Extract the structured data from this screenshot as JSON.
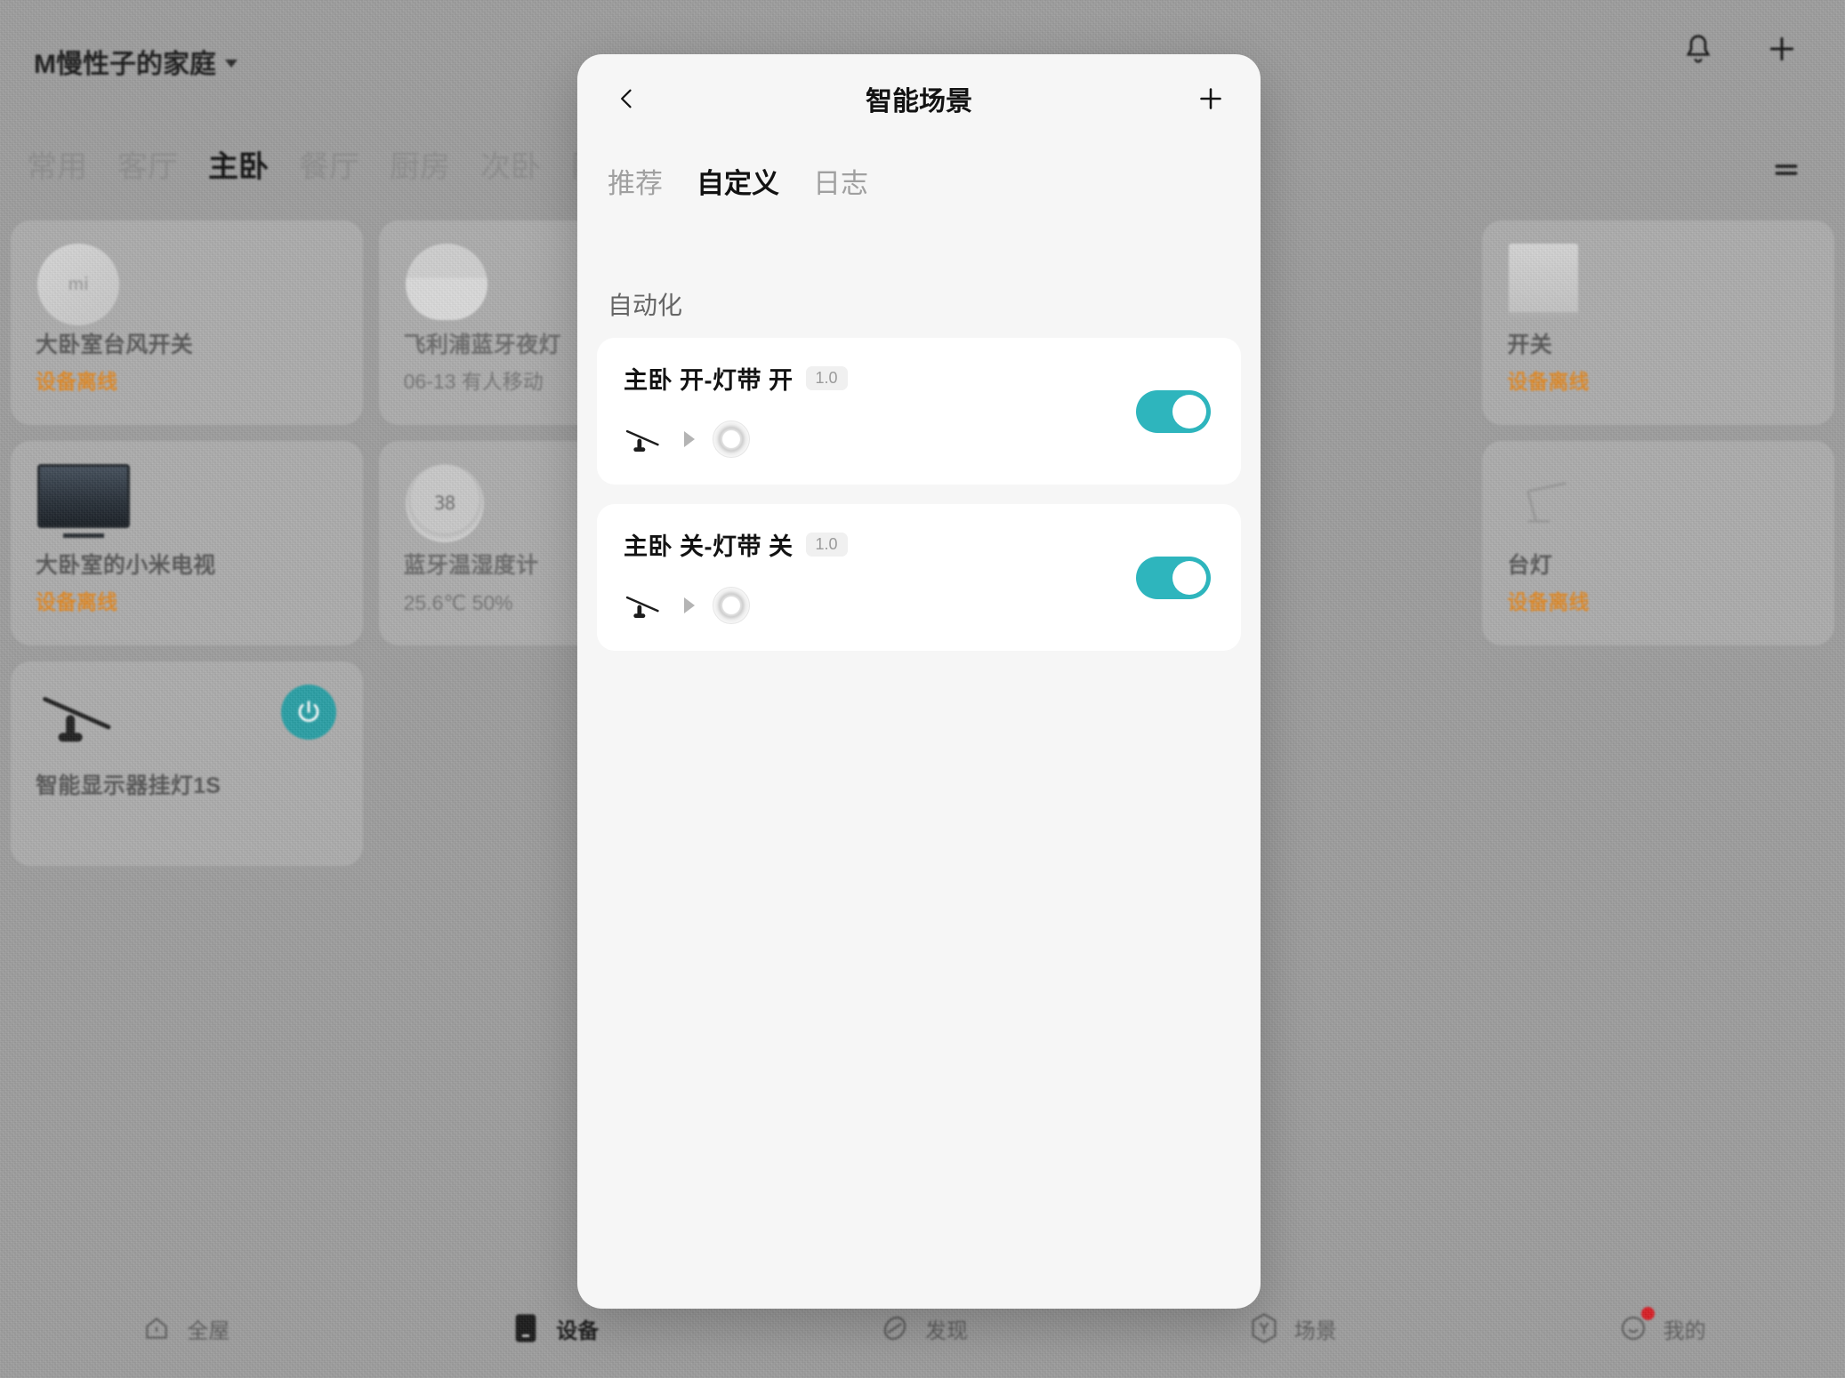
{
  "header": {
    "home_name": "M慢性子的家庭",
    "caret_icon": "chevron-down-icon",
    "bell_icon": "bell-icon",
    "add_icon": "plus-icon"
  },
  "room_tabs": {
    "items": [
      {
        "label": "常用",
        "active": false
      },
      {
        "label": "客厅",
        "active": false
      },
      {
        "label": "主卧",
        "active": true
      },
      {
        "label": "餐厅",
        "active": false
      },
      {
        "label": "厨房",
        "active": false
      },
      {
        "label": "次卧",
        "active": false
      },
      {
        "label": "阳",
        "active": false
      }
    ],
    "menu_icon": "list-menu-icon"
  },
  "devices": [
    {
      "name": "大卧室台风开关",
      "status": "设备离线",
      "offline": true,
      "thumb": "round-switch-icon",
      "power": false
    },
    {
      "name": "飞利浦蓝牙夜灯",
      "status": "06-13 有人移动",
      "offline": false,
      "thumb": "nightlight-icon",
      "power": false
    },
    {
      "name": "",
      "status": "",
      "offline": false,
      "thumb": "",
      "power": false
    },
    {
      "name": "开关",
      "status": "设备离线",
      "offline": true,
      "thumb": "square-switch-icon",
      "power": false
    },
    {
      "name": "大卧室的小米电视",
      "status": "设备离线",
      "offline": true,
      "thumb": "tv-icon",
      "power": false
    },
    {
      "name": "蓝牙温湿度计",
      "status": "25.6℃ 50%",
      "offline": false,
      "thumb": "thermometer-icon",
      "power": false
    },
    {
      "name": "",
      "status": "",
      "offline": false,
      "thumb": "",
      "power": false
    },
    {
      "name": "台灯",
      "status": "设备离线",
      "offline": true,
      "thumb": "desklamp-icon",
      "power": false
    },
    {
      "name": "智能显示器挂灯1S",
      "status": "",
      "offline": false,
      "thumb": "monitor-light-icon",
      "power": true
    }
  ],
  "device_thermo_display": "38",
  "device_switch_brand": "mi",
  "modal": {
    "back_icon": "chevron-left-icon",
    "title": "智能场景",
    "add_icon": "plus-icon",
    "tabs": [
      {
        "label": "推荐",
        "active": false
      },
      {
        "label": "自定义",
        "active": true
      },
      {
        "label": "日志",
        "active": false
      }
    ],
    "section_title": "自动化",
    "automations": [
      {
        "title": "主卧 开-灯带 开",
        "version_badge": "1.0",
        "trigger_icon": "monitor-light-icon",
        "arrow_icon": "arrow-right-icon",
        "action_icon": "light-ring-icon",
        "enabled": true
      },
      {
        "title": "主卧 关-灯带 关",
        "version_badge": "1.0",
        "trigger_icon": "monitor-light-icon",
        "arrow_icon": "arrow-right-icon",
        "action_icon": "light-ring-icon",
        "enabled": true
      }
    ]
  },
  "bottom_nav": [
    {
      "label": "全屋",
      "icon": "home-icon",
      "active": false,
      "badge": false
    },
    {
      "label": "设备",
      "icon": "device-icon",
      "active": true,
      "badge": false
    },
    {
      "label": "发现",
      "icon": "discover-icon",
      "active": false,
      "badge": false
    },
    {
      "label": "场景",
      "icon": "scene-icon",
      "active": false,
      "badge": false
    },
    {
      "label": "我的",
      "icon": "profile-icon",
      "active": false,
      "badge": true
    }
  ],
  "colors": {
    "accent_teal": "#2eb5bd",
    "power_teal": "#2ba0a6",
    "offline_orange": "#e08a28",
    "badge_red": "#d81f26"
  }
}
